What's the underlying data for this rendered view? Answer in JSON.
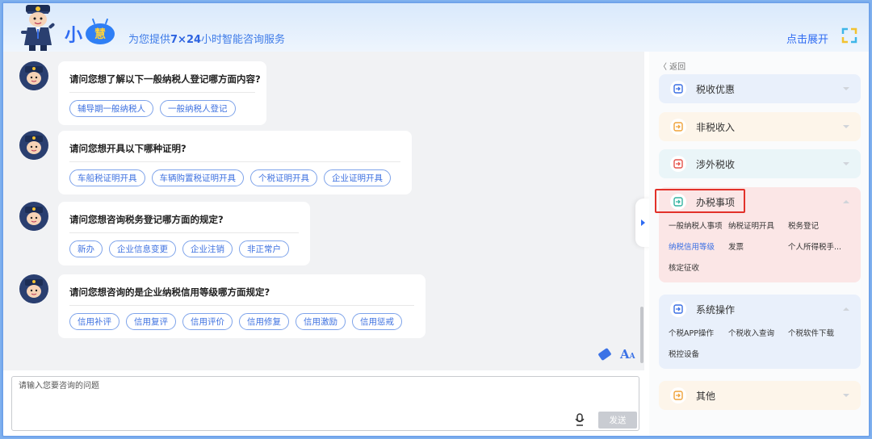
{
  "header": {
    "logo_xiao": "小",
    "logo_hui": "慧",
    "slogan_prefix": "为您提供",
    "slogan_highlight": "7×24",
    "slogan_suffix": "小时智能咨询服务",
    "expand_label": "点击展开"
  },
  "messages": [
    {
      "question": "请问您想了解以下一般纳税人登记哪方面内容?",
      "options": [
        "辅导期一般纳税人",
        "一般纳税人登记"
      ]
    },
    {
      "question": "请问您想开具以下哪种证明?",
      "options": [
        "车船税证明开具",
        "车辆购置税证明开具",
        "个税证明开具",
        "企业证明开具"
      ]
    },
    {
      "question": "请问您想咨询税务登记哪方面的规定?",
      "options": [
        "新办",
        "企业信息变更",
        "企业注销",
        "非正常户"
      ]
    },
    {
      "question": "请问您想咨询的是企业纳税信用等级哪方面规定?",
      "options": [
        "信用补评",
        "信用复评",
        "信用评价",
        "信用修复",
        "信用激励",
        "信用惩戒"
      ]
    }
  ],
  "input": {
    "placeholder": "请输入您要咨询的问题",
    "send_label": "发送"
  },
  "panel": {
    "back_label": "〈 返回",
    "categories": [
      {
        "label": "税收优惠",
        "color": "#e9f0fb",
        "icon_color": "#3a6fe4",
        "expanded": false
      },
      {
        "label": "非税收入",
        "color": "#fdf5ea",
        "icon_color": "#f0a33a",
        "expanded": false
      },
      {
        "label": "涉外税收",
        "color": "#eaf5f8",
        "icon_color": "#e5534b",
        "expanded": false
      },
      {
        "label": "办税事项",
        "color": "#fbe6e6",
        "icon_color": "#32b3a0",
        "expanded": true,
        "items": [
          "一般纳税人事项",
          "纳税证明开具",
          "税务登记",
          "纳税信用等级",
          "发票",
          "个人所得税手...",
          "核定征收"
        ],
        "active_index": 3
      },
      {
        "label": "系统操作",
        "color": "#e9f0fb",
        "icon_color": "#3a6fe4",
        "expanded": true,
        "items": [
          "个税APP操作",
          "个税收入查询",
          "个税软件下载",
          "税控设备"
        ]
      },
      {
        "label": "其他",
        "color": "#fdf5ea",
        "icon_color": "#f0a33a",
        "expanded": false
      }
    ]
  }
}
